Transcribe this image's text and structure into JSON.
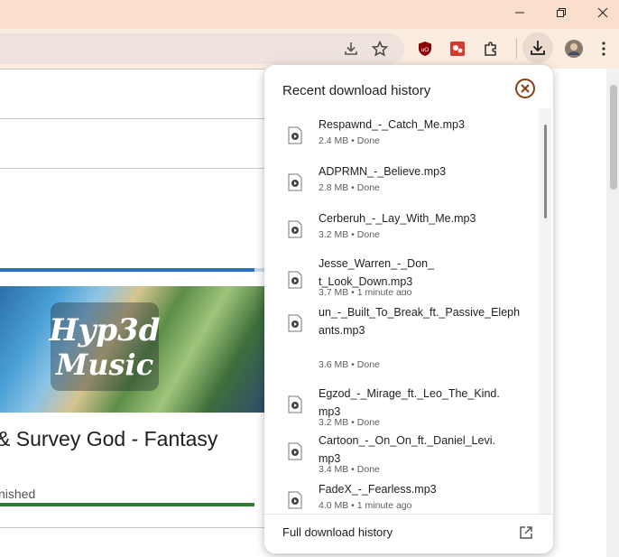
{
  "window_controls": {
    "minimize_icon": "minimize-icon",
    "restore_icon": "restore-icon",
    "close_icon": "close-icon"
  },
  "toolbar": {
    "icons": [
      "download-page-icon",
      "bookmark-star-icon",
      "ublock-origin-icon",
      "extension-red-icon",
      "extensions-puzzle-icon",
      "downloads-icon",
      "profile-avatar",
      "menu-kebab-icon"
    ]
  },
  "page": {
    "thumbnail_logo": "Hyp3d Music",
    "video_title": "& Survey God - Fantasy",
    "status_text": "nished"
  },
  "downloads": {
    "title": "Recent download history",
    "items": [
      {
        "name": "Respawnd_-_Catch_Me.mp3",
        "meta": "2.4 MB • Done"
      },
      {
        "name": "ADPRMN_-_Believe.mp3",
        "meta": "2.8 MB • Done"
      },
      {
        "name": "Cerberuh_-_Lay_With_Me.mp3",
        "meta": "3.2 MB • Done"
      },
      {
        "name": "Jesse_Warren_-_Don_t_Look_Down.mp3",
        "meta": "3.7 MB • 1 minute ago"
      },
      {
        "name": "un_-_Built_To_Break_ft._Passive_Elephants.mp3",
        "meta": "3.6 MB • Done"
      },
      {
        "name": "Egzod_-_Mirage_ft._Leo_The_Kind.mp3",
        "meta": "3.2 MB • Done"
      },
      {
        "name": "Cartoon_-_On_On_ft._Daniel_Levi.mp3",
        "meta": "3.4 MB • Done"
      },
      {
        "name": "FadeX_-_Fearless.mp3",
        "meta": "4.0 MB • 1 minute ago"
      }
    ],
    "footer_label": "Full download history"
  },
  "colors": {
    "titlebar": "#f9dfcc",
    "toolbar": "#fbece0",
    "progress_blue": "#2b6fc4",
    "progress_green": "#2e7d32",
    "close_accent": "#8a3d12"
  }
}
